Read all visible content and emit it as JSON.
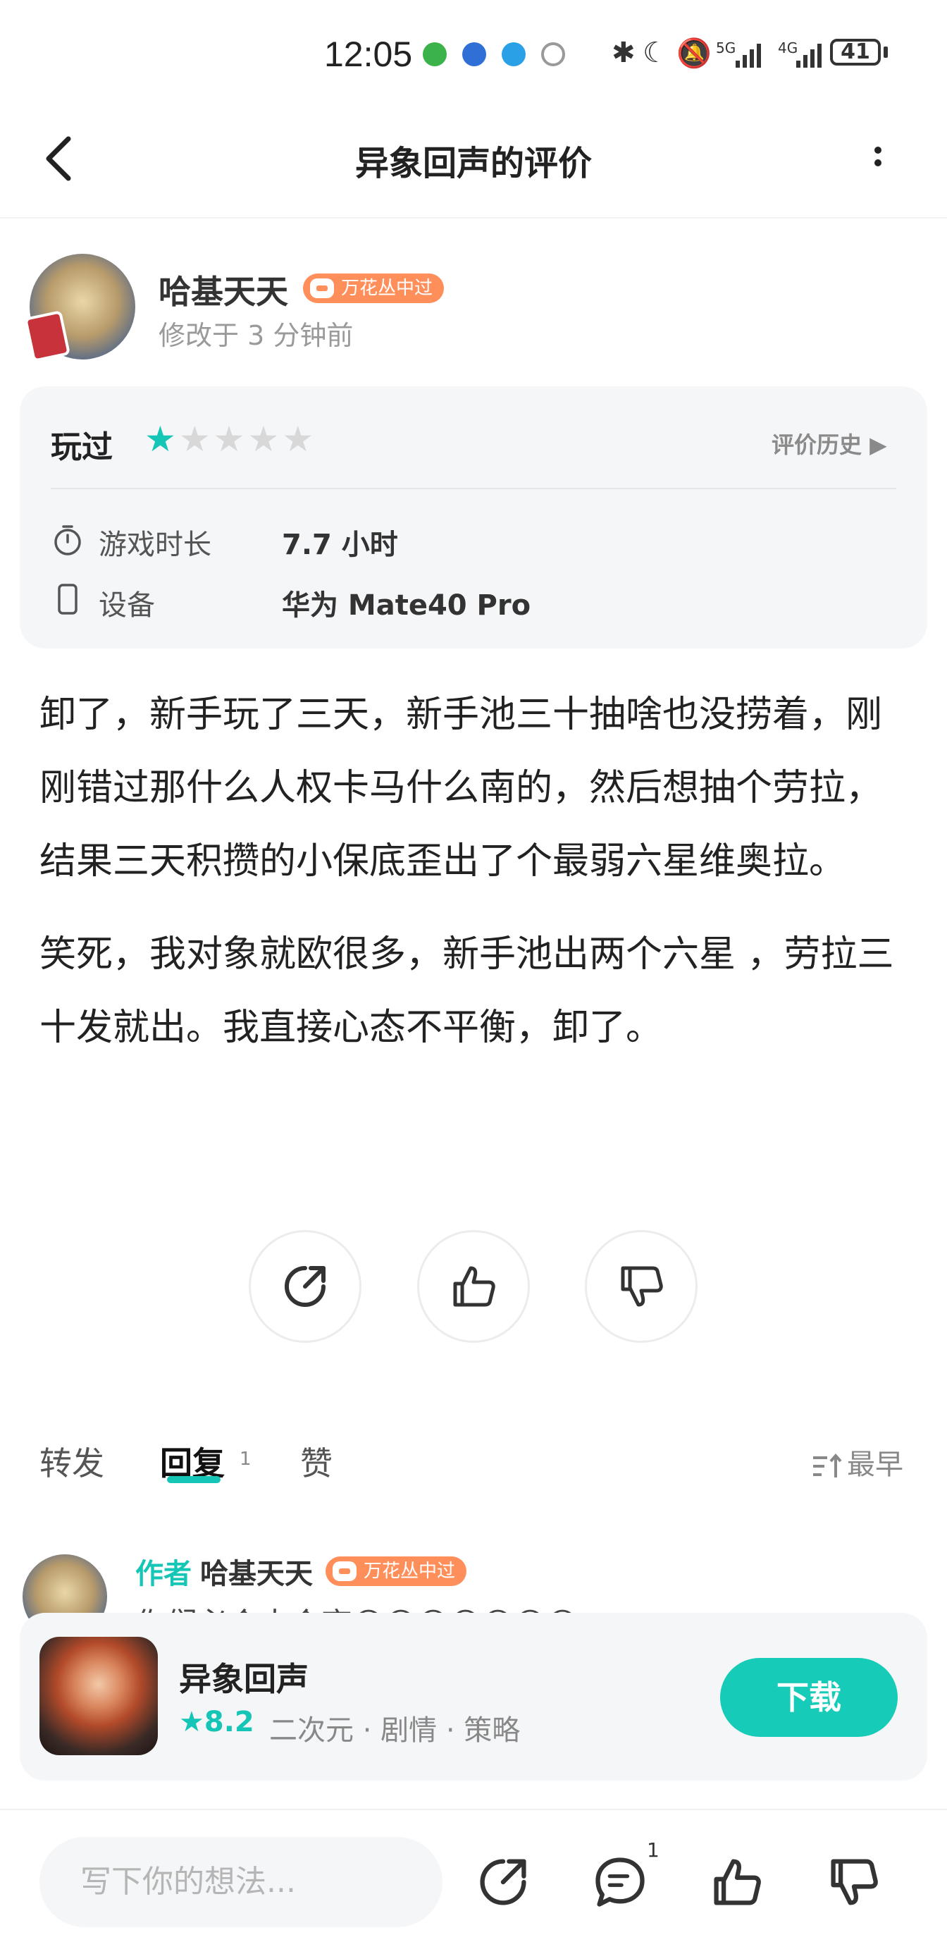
{
  "status_bar": {
    "time": "12:05",
    "network1": "5G",
    "network2": "4G",
    "battery": "41"
  },
  "header": {
    "title": "异象回声的评价"
  },
  "author": {
    "name": "哈基天天",
    "badge": "万花丛中过",
    "modified": "修改于 3 分钟前"
  },
  "rating": {
    "status_label": "玩过",
    "stars_filled": 1,
    "stars_total": 5,
    "history_label": "评价历史 ▶",
    "playtime_label": "游戏时长",
    "playtime_value": "7.7 小时",
    "device_label": "设备",
    "device_value": "华为 Mate40 Pro"
  },
  "review": {
    "paragraph1": "卸了，新手玩了三天，新手池三十抽啥也没捞着，刚刚错过那什么人权卡马什么南的，然后想抽个劳拉，结果三天积攒的小保底歪出了个最弱六星维奥拉。",
    "paragraph2": "笑死，我对象就欧很多，新手池出两个六星 ，劳拉三十发就出。我直接心态不平衡，卸了。"
  },
  "tabs": {
    "forward": "转发",
    "reply": "回复",
    "reply_count": "1",
    "like": "赞",
    "sort": "最早"
  },
  "reply_preview": {
    "author_tag": "作者",
    "name": "哈基天天",
    "badge": "万花丛中过",
    "text": "你们必会大会齐😄😄😄😄😄😄😄"
  },
  "game": {
    "name": "异象回声",
    "score": "★8.2",
    "tags": "二次元 · 剧情 · 策略",
    "download": "下载"
  },
  "bottom_bar": {
    "placeholder": "写下你的想法...",
    "comment_count": "1"
  },
  "colors": {
    "accent": "#15c5b5",
    "badge": "#ff8f5a",
    "card_bg": "#f5f6f8"
  }
}
